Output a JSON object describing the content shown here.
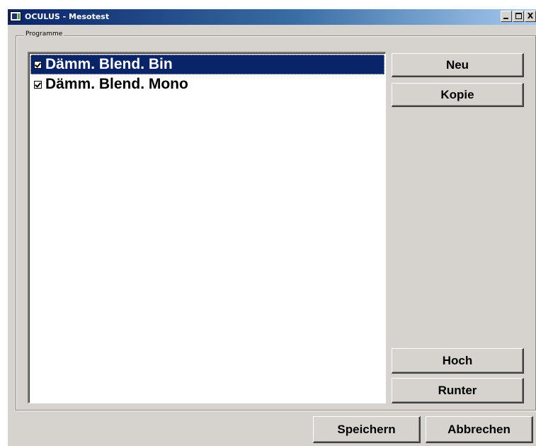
{
  "window": {
    "title": "OCULUS - Mesotest",
    "controls": {
      "minimize": "",
      "maximize": "",
      "close": "X"
    }
  },
  "group": {
    "label": "Programme"
  },
  "programs": [
    {
      "label": "Dämm. Blend. Bin",
      "checked": true,
      "selected": true
    },
    {
      "label": "Dämm. Blend. Mono",
      "checked": true,
      "selected": false
    }
  ],
  "buttons": {
    "new": "Neu",
    "copy": "Kopie",
    "up": "Hoch",
    "down": "Runter",
    "save": "Speichern",
    "cancel": "Abbrechen"
  },
  "colors": {
    "selection": "#0a246a",
    "face": "#d6d3ce"
  }
}
